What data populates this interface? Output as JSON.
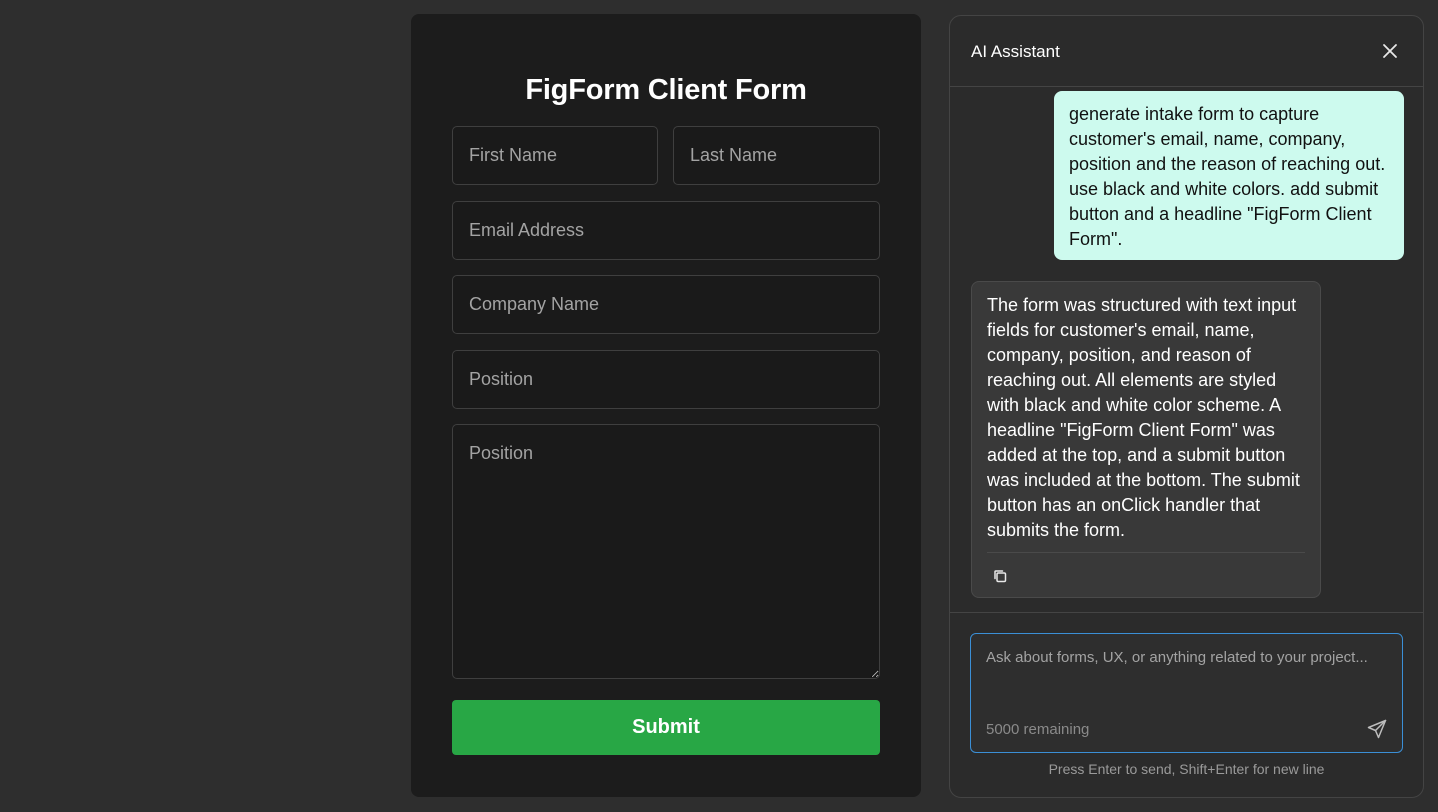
{
  "form": {
    "title": "FigForm Client Form",
    "fields": {
      "first_name": {
        "placeholder": "First Name"
      },
      "last_name": {
        "placeholder": "Last Name"
      },
      "email": {
        "placeholder": "Email Address"
      },
      "company": {
        "placeholder": "Company Name"
      },
      "position": {
        "placeholder": "Position"
      },
      "reason": {
        "placeholder": "Position"
      }
    },
    "submit_label": "Submit",
    "submit_color": "#28a745"
  },
  "assistant": {
    "title": "AI Assistant",
    "close_icon": "close-icon",
    "messages": [
      {
        "role": "user",
        "text": "generate intake form to capture customer's email, name, company, position and the reason of reaching out. use black and white colors. add submit button and a headline \"FigForm Client Form\"."
      },
      {
        "role": "assistant",
        "text": "The form was structured with text input fields for customer's email, name, company, position, and reason of reaching out. All elements are styled with black and white color scheme. A headline \"FigForm Client Form\" was added at the top, and a submit button was included at the bottom. The submit button has an onClick handler that submits the form."
      }
    ],
    "input": {
      "placeholder": "Ask about forms, UX, or anything related to your project...",
      "value": "",
      "remaining": "5000 remaining"
    },
    "hint": "Press Enter to send, Shift+Enter for new line",
    "colors": {
      "user_bubble": "#cdfaee",
      "assistant_bubble": "#393939",
      "input_focus": "#3b8fd6"
    }
  }
}
